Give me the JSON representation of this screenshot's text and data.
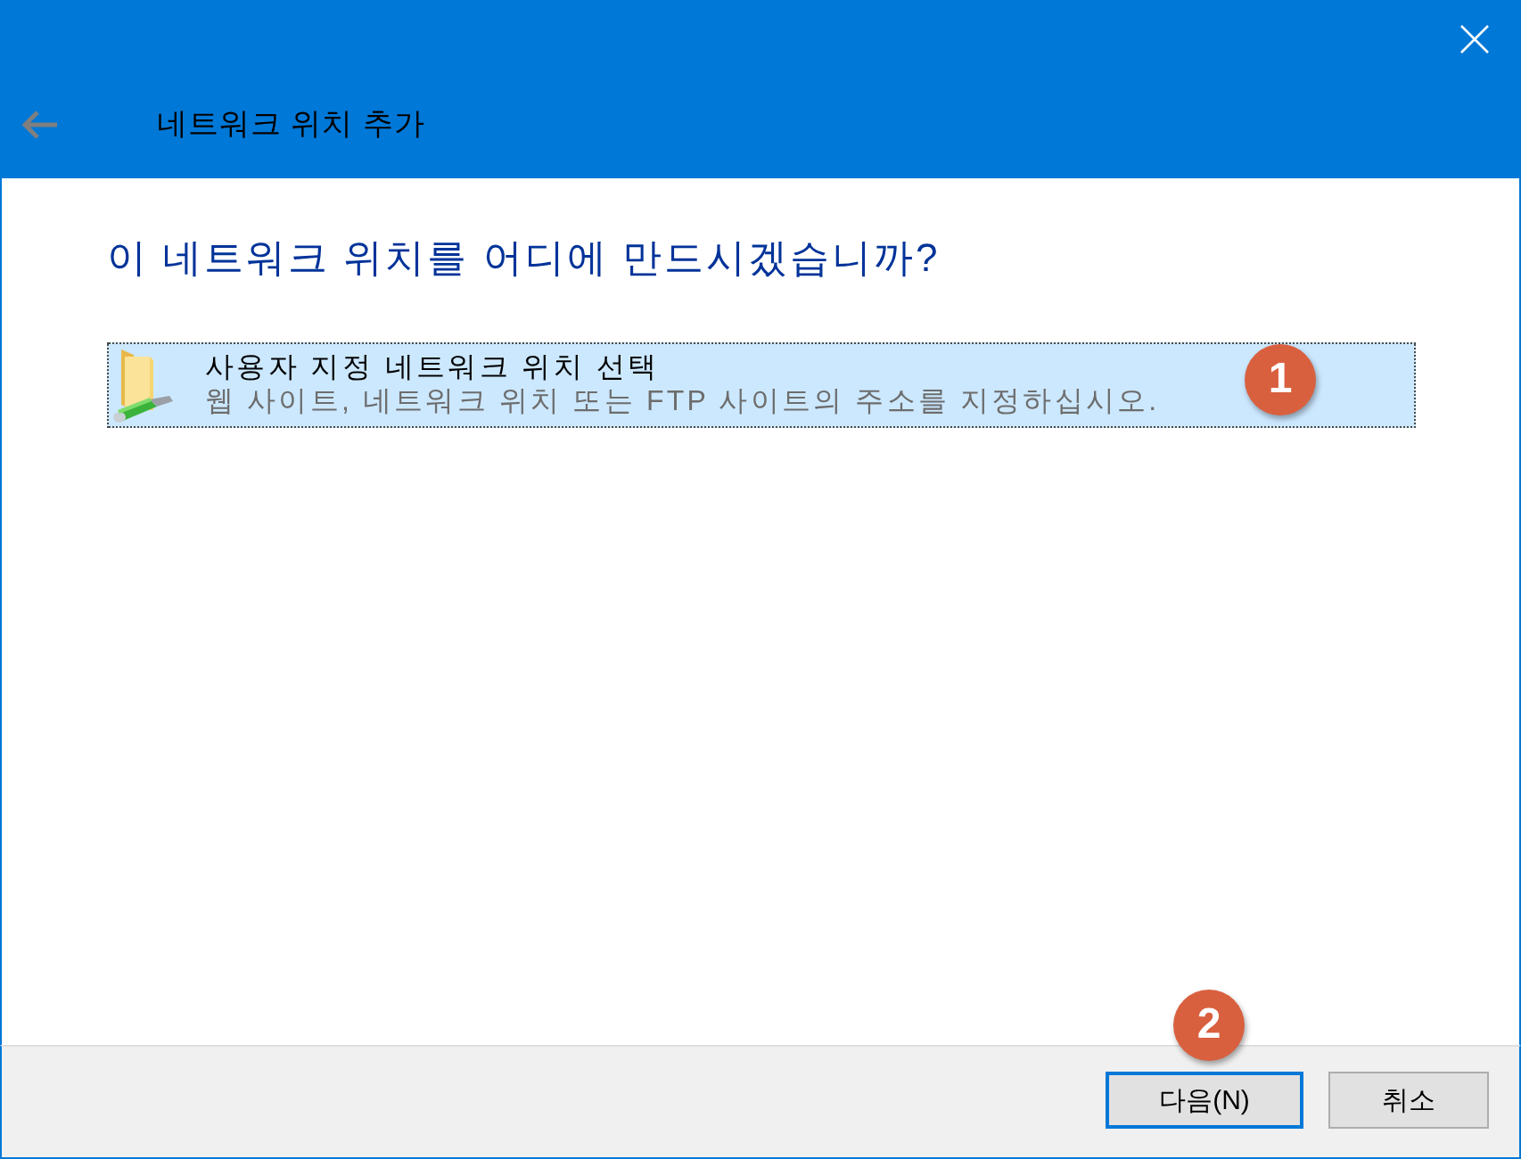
{
  "title_bar": {
    "back_button": {
      "disabled": true
    },
    "title": "네트워크 위치 추가"
  },
  "heading": "이 네트워크 위치를 어디에 만드시겠습니까?",
  "options": [
    {
      "title": "사용자 지정 네트워크 위치 선택",
      "description": "웹 사이트, 네트워크 위치 또는 FTP 사이트의 주소를 지정하십시오.",
      "selected": true,
      "callout": "1"
    }
  ],
  "buttons": [
    {
      "label": "다음(N)",
      "default": true,
      "callout": "2"
    },
    {
      "label": "취소",
      "default": false
    }
  ]
}
